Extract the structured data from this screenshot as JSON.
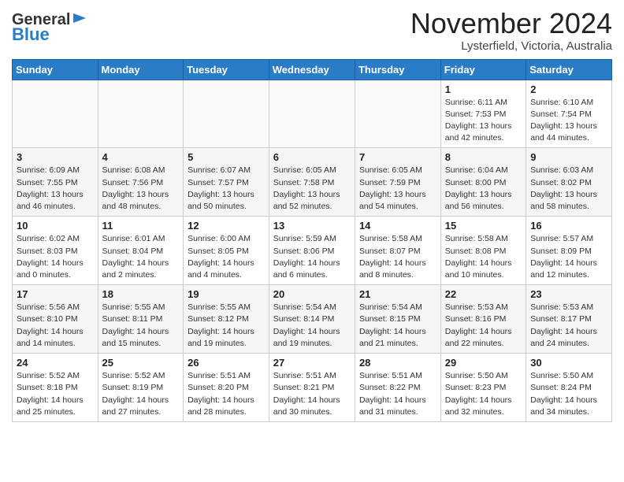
{
  "header": {
    "logo_line1": "General",
    "logo_line2": "Blue",
    "month": "November 2024",
    "location": "Lysterfield, Victoria, Australia"
  },
  "weekdays": [
    "Sunday",
    "Monday",
    "Tuesday",
    "Wednesday",
    "Thursday",
    "Friday",
    "Saturday"
  ],
  "weeks": [
    [
      {
        "day": "",
        "info": "",
        "empty": true
      },
      {
        "day": "",
        "info": "",
        "empty": true
      },
      {
        "day": "",
        "info": "",
        "empty": true
      },
      {
        "day": "",
        "info": "",
        "empty": true
      },
      {
        "day": "",
        "info": "",
        "empty": true
      },
      {
        "day": "1",
        "info": "Sunrise: 6:11 AM\nSunset: 7:53 PM\nDaylight: 13 hours\nand 42 minutes.",
        "empty": false
      },
      {
        "day": "2",
        "info": "Sunrise: 6:10 AM\nSunset: 7:54 PM\nDaylight: 13 hours\nand 44 minutes.",
        "empty": false
      }
    ],
    [
      {
        "day": "3",
        "info": "Sunrise: 6:09 AM\nSunset: 7:55 PM\nDaylight: 13 hours\nand 46 minutes.",
        "empty": false
      },
      {
        "day": "4",
        "info": "Sunrise: 6:08 AM\nSunset: 7:56 PM\nDaylight: 13 hours\nand 48 minutes.",
        "empty": false
      },
      {
        "day": "5",
        "info": "Sunrise: 6:07 AM\nSunset: 7:57 PM\nDaylight: 13 hours\nand 50 minutes.",
        "empty": false
      },
      {
        "day": "6",
        "info": "Sunrise: 6:05 AM\nSunset: 7:58 PM\nDaylight: 13 hours\nand 52 minutes.",
        "empty": false
      },
      {
        "day": "7",
        "info": "Sunrise: 6:05 AM\nSunset: 7:59 PM\nDaylight: 13 hours\nand 54 minutes.",
        "empty": false
      },
      {
        "day": "8",
        "info": "Sunrise: 6:04 AM\nSunset: 8:00 PM\nDaylight: 13 hours\nand 56 minutes.",
        "empty": false
      },
      {
        "day": "9",
        "info": "Sunrise: 6:03 AM\nSunset: 8:02 PM\nDaylight: 13 hours\nand 58 minutes.",
        "empty": false
      }
    ],
    [
      {
        "day": "10",
        "info": "Sunrise: 6:02 AM\nSunset: 8:03 PM\nDaylight: 14 hours\nand 0 minutes.",
        "empty": false
      },
      {
        "day": "11",
        "info": "Sunrise: 6:01 AM\nSunset: 8:04 PM\nDaylight: 14 hours\nand 2 minutes.",
        "empty": false
      },
      {
        "day": "12",
        "info": "Sunrise: 6:00 AM\nSunset: 8:05 PM\nDaylight: 14 hours\nand 4 minutes.",
        "empty": false
      },
      {
        "day": "13",
        "info": "Sunrise: 5:59 AM\nSunset: 8:06 PM\nDaylight: 14 hours\nand 6 minutes.",
        "empty": false
      },
      {
        "day": "14",
        "info": "Sunrise: 5:58 AM\nSunset: 8:07 PM\nDaylight: 14 hours\nand 8 minutes.",
        "empty": false
      },
      {
        "day": "15",
        "info": "Sunrise: 5:58 AM\nSunset: 8:08 PM\nDaylight: 14 hours\nand 10 minutes.",
        "empty": false
      },
      {
        "day": "16",
        "info": "Sunrise: 5:57 AM\nSunset: 8:09 PM\nDaylight: 14 hours\nand 12 minutes.",
        "empty": false
      }
    ],
    [
      {
        "day": "17",
        "info": "Sunrise: 5:56 AM\nSunset: 8:10 PM\nDaylight: 14 hours\nand 14 minutes.",
        "empty": false
      },
      {
        "day": "18",
        "info": "Sunrise: 5:55 AM\nSunset: 8:11 PM\nDaylight: 14 hours\nand 15 minutes.",
        "empty": false
      },
      {
        "day": "19",
        "info": "Sunrise: 5:55 AM\nSunset: 8:12 PM\nDaylight: 14 hours\nand 19 minutes.",
        "empty": false
      },
      {
        "day": "20",
        "info": "Sunrise: 5:54 AM\nSunset: 8:14 PM\nDaylight: 14 hours\nand 19 minutes.",
        "empty": false
      },
      {
        "day": "21",
        "info": "Sunrise: 5:54 AM\nSunset: 8:15 PM\nDaylight: 14 hours\nand 21 minutes.",
        "empty": false
      },
      {
        "day": "22",
        "info": "Sunrise: 5:53 AM\nSunset: 8:16 PM\nDaylight: 14 hours\nand 22 minutes.",
        "empty": false
      },
      {
        "day": "23",
        "info": "Sunrise: 5:53 AM\nSunset: 8:17 PM\nDaylight: 14 hours\nand 24 minutes.",
        "empty": false
      }
    ],
    [
      {
        "day": "24",
        "info": "Sunrise: 5:52 AM\nSunset: 8:18 PM\nDaylight: 14 hours\nand 25 minutes.",
        "empty": false
      },
      {
        "day": "25",
        "info": "Sunrise: 5:52 AM\nSunset: 8:19 PM\nDaylight: 14 hours\nand 27 minutes.",
        "empty": false
      },
      {
        "day": "26",
        "info": "Sunrise: 5:51 AM\nSunset: 8:20 PM\nDaylight: 14 hours\nand 28 minutes.",
        "empty": false
      },
      {
        "day": "27",
        "info": "Sunrise: 5:51 AM\nSunset: 8:21 PM\nDaylight: 14 hours\nand 30 minutes.",
        "empty": false
      },
      {
        "day": "28",
        "info": "Sunrise: 5:51 AM\nSunset: 8:22 PM\nDaylight: 14 hours\nand 31 minutes.",
        "empty": false
      },
      {
        "day": "29",
        "info": "Sunrise: 5:50 AM\nSunset: 8:23 PM\nDaylight: 14 hours\nand 32 minutes.",
        "empty": false
      },
      {
        "day": "30",
        "info": "Sunrise: 5:50 AM\nSunset: 8:24 PM\nDaylight: 14 hours\nand 34 minutes.",
        "empty": false
      }
    ]
  ]
}
